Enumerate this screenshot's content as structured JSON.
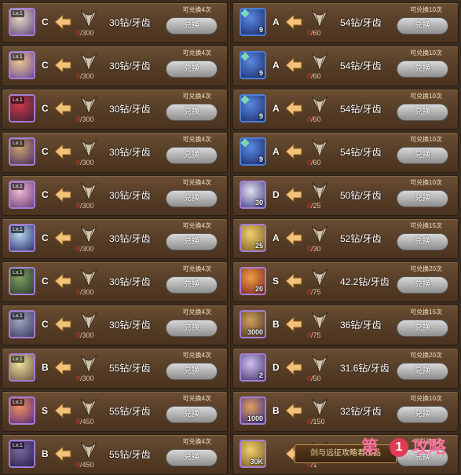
{
  "colors": {
    "progress_current": "#e23a2a",
    "button": "#b5b5b5",
    "row_bg": "#5d432b"
  },
  "left": [
    {
      "grade": "C",
      "icon": "hero-portrait-icon",
      "lv": "Lv.1",
      "current": "0",
      "total": "/300",
      "price": "30钻/牙齿",
      "limit": "可兑换4次",
      "button": "兑换",
      "c1": "#e8d7c0",
      "c2": "#5e4a80"
    },
    {
      "grade": "C",
      "icon": "hero-portrait-icon",
      "lv": "Lv.1",
      "current": "0",
      "total": "/300",
      "price": "30钻/牙齿",
      "limit": "可兑换4次",
      "button": "兑换",
      "c1": "#f0c890",
      "c2": "#6a4a9a"
    },
    {
      "grade": "C",
      "icon": "hero-portrait-icon",
      "lv": "Lv.1",
      "current": "0",
      "total": "/300",
      "price": "30钻/牙齿",
      "limit": "可兑换4次",
      "button": "兑换",
      "c1": "#d03a4a",
      "c2": "#40203a"
    },
    {
      "grade": "C",
      "icon": "hero-portrait-icon",
      "lv": "Lv.1",
      "current": "0",
      "total": "/300",
      "price": "30钻/牙齿",
      "limit": "可兑换4次",
      "button": "兑换",
      "c1": "#c9a070",
      "c2": "#4a3060"
    },
    {
      "grade": "C",
      "icon": "hero-portrait-icon",
      "lv": "Lv.1",
      "current": "0",
      "total": "/300",
      "price": "30钻/牙齿",
      "limit": "可兑换4次",
      "button": "兑换",
      "c1": "#f2b8d6",
      "c2": "#6a3f7a"
    },
    {
      "grade": "C",
      "icon": "hero-portrait-icon",
      "lv": "Lv.1",
      "current": "0",
      "total": "/300",
      "price": "30钻/牙齿",
      "limit": "可兑换4次",
      "button": "兑换",
      "c1": "#b8d8f0",
      "c2": "#2a2f6a"
    },
    {
      "grade": "C",
      "icon": "hero-portrait-icon",
      "lv": "Lv.1",
      "current": "0",
      "total": "/300",
      "price": "30钻/牙齿",
      "limit": "可兑换4次",
      "button": "兑换",
      "c1": "#7fa060",
      "c2": "#2a3a30"
    },
    {
      "grade": "C",
      "icon": "hero-portrait-icon",
      "lv": "Lv.1",
      "current": "0",
      "total": "/300",
      "price": "30钻/牙齿",
      "limit": "可兑换4次",
      "button": "兑换",
      "c1": "#a0a8c0",
      "c2": "#3a3a60"
    },
    {
      "grade": "B",
      "icon": "hero-portrait-icon",
      "lv": "Lv.1",
      "current": "0",
      "total": "/300",
      "price": "55钻/牙齿",
      "limit": "可兑换4次",
      "button": "兑换",
      "c1": "#f0e0a0",
      "c2": "#6a5a40"
    },
    {
      "grade": "S",
      "icon": "hero-portrait-icon",
      "lv": "Lv.1",
      "current": "0",
      "total": "/450",
      "price": "55钻/牙齿",
      "limit": "可兑换4次",
      "button": "兑换",
      "c1": "#f09060",
      "c2": "#5a2a7a"
    },
    {
      "grade": "B",
      "icon": "hero-portrait-icon",
      "lv": "Lv.1",
      "current": "0",
      "total": "/450",
      "price": "55钻/牙齿",
      "limit": "可兑换4次",
      "button": "兑换",
      "c1": "#7a6aa0",
      "c2": "#2a1f4a"
    }
  ],
  "right": [
    {
      "grade": "A",
      "icon": "card-icon",
      "qty": "9",
      "current": "0",
      "total": "/60",
      "price": "54钻/牙齿",
      "limit": "可兑换10次",
      "button": "兑换",
      "c1": "#5a8ae0",
      "c2": "#1a2a6a"
    },
    {
      "grade": "A",
      "icon": "card-icon",
      "qty": "9",
      "current": "0",
      "total": "/60",
      "price": "54钻/牙齿",
      "limit": "可兑换10次",
      "button": "兑换",
      "c1": "#5a8ae0",
      "c2": "#1a2a6a"
    },
    {
      "grade": "A",
      "icon": "card-icon",
      "qty": "9",
      "current": "0",
      "total": "/60",
      "price": "54钻/牙齿",
      "limit": "可兑换10次",
      "button": "兑换",
      "c1": "#5a8ae0",
      "c2": "#1a2a6a"
    },
    {
      "grade": "A",
      "icon": "card-icon",
      "qty": "9",
      "current": "0",
      "total": "/60",
      "price": "54钻/牙齿",
      "limit": "可兑换10次",
      "button": "兑换",
      "c1": "#5a8ae0",
      "c2": "#1a2a6a"
    },
    {
      "grade": "D",
      "icon": "silver-orb-icon",
      "qty": "30",
      "current": "0",
      "total": "/25",
      "price": "50钻/牙齿",
      "limit": "可兑换10次",
      "button": "兑换",
      "c1": "#e0e0f0",
      "c2": "#3a3a80"
    },
    {
      "grade": "A",
      "icon": "gold-coin-icon",
      "qty": "25",
      "current": "0",
      "total": "/30",
      "price": "52钻/牙齿",
      "limit": "可兑换15次",
      "button": "兑换",
      "c1": "#f0d070",
      "c2": "#7a5a20"
    },
    {
      "grade": "S",
      "icon": "fire-orb-icon",
      "qty": "20",
      "current": "0",
      "total": "/75",
      "price": "42.2钻/牙齿",
      "limit": "可兑换20次",
      "button": "兑换",
      "c1": "#f0a040",
      "c2": "#7a2020"
    },
    {
      "grade": "B",
      "icon": "gear-medal-icon",
      "qty": "3000",
      "current": "0",
      "total": "/75",
      "price": "36钻/牙齿",
      "limit": "可兑换15次",
      "button": "兑换",
      "c1": "#d0a060",
      "c2": "#4a3020"
    },
    {
      "grade": "D",
      "icon": "scroll-icon",
      "qty": "2",
      "current": "0",
      "total": "/50",
      "price": "31.6钻/牙齿",
      "limit": "可兑换20次",
      "button": "兑换",
      "c1": "#d0c0f0",
      "c2": "#40306a"
    },
    {
      "grade": "B",
      "icon": "sword-icon",
      "qty": "1000",
      "current": "0",
      "total": "/150",
      "price": "32钻/牙齿",
      "limit": "可兑换10次",
      "button": "兑换",
      "c1": "#e0a060",
      "c2": "#3a2a80"
    },
    {
      "grade": "",
      "icon": "gold-coin-icon",
      "qty": "30K",
      "current": "0",
      "total": "/1",
      "price": "",
      "limit": "可兑换1次",
      "button": "兑换",
      "c1": "#f0d070",
      "c2": "#7a5a20"
    }
  ],
  "banner": "剑与远征攻略君出品",
  "watermark": {
    "left": "第",
    "num": "1",
    "right": "攻略"
  }
}
